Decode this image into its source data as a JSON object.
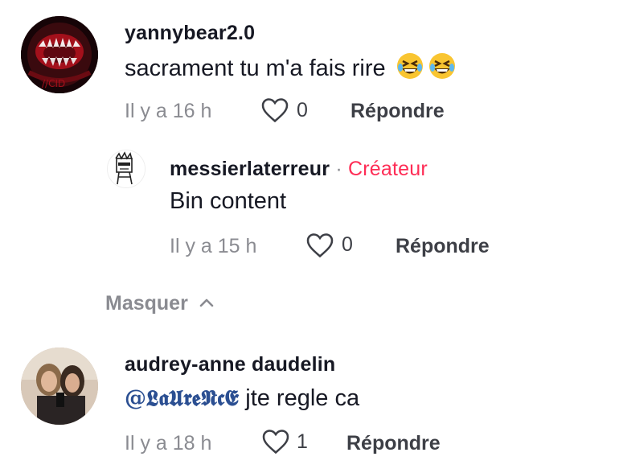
{
  "comments": [
    {
      "username": "yannybear2.0",
      "text": "sacrament tu m'a fais rire",
      "emoji": "🤣🤣",
      "time": "Il y a 16 h",
      "likes": "0",
      "reply_label": "Répondre"
    },
    {
      "username": "messierlaterreur",
      "separator": "·",
      "badge": "Créateur",
      "text": "Bin content",
      "time": "Il y a 15 h",
      "likes": "0",
      "reply_label": "Répondre"
    },
    {
      "username": "audrey-anne daudelin",
      "mention": "@𝕷𝖆𝖀𝖗𝖊𝕹𝖈𝕰",
      "text": "jte regle ca",
      "time": "Il y a 18 h",
      "likes": "1",
      "reply_label": "Répondre"
    }
  ],
  "collapse": {
    "label": "Masquer",
    "icon": "chevron-up-icon"
  },
  "colors": {
    "creator_badge": "#fe2c55",
    "meta": "#8a8b91",
    "mention": "#2b4f92"
  }
}
